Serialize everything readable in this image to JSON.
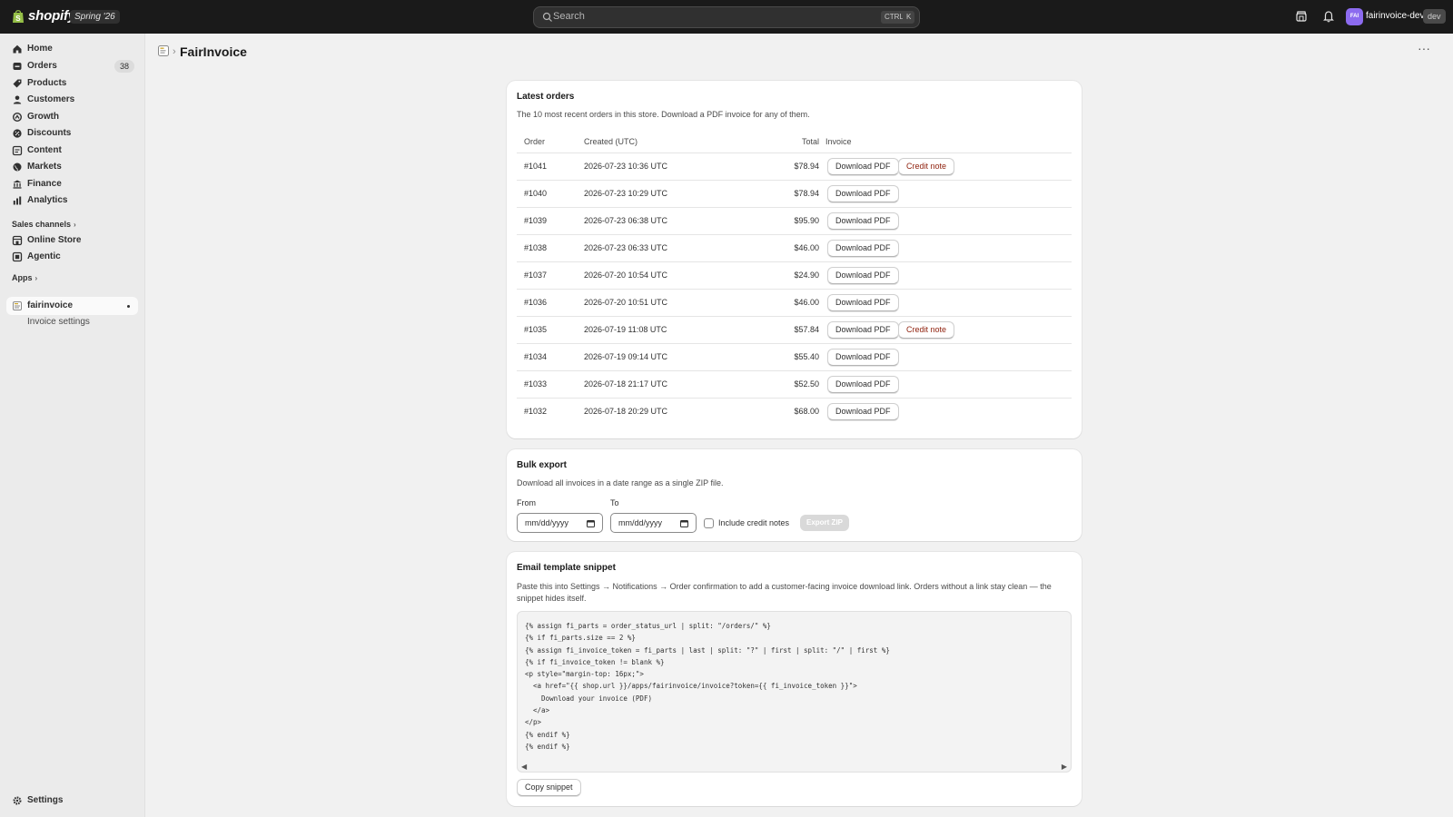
{
  "topbar": {
    "brand": "shopify",
    "edition": "Spring '26",
    "search_placeholder": "Search",
    "shortcut_ctrl": "CTRL",
    "shortcut_key": "K",
    "avatar_initials": "FAI",
    "store_name": "fairinvoice-dev",
    "env_badge": "dev"
  },
  "sidebar": {
    "items": [
      {
        "label": "Home",
        "icon": "home-icon"
      },
      {
        "label": "Orders",
        "icon": "orders-icon",
        "badge": "38"
      },
      {
        "label": "Products",
        "icon": "tag-icon"
      },
      {
        "label": "Customers",
        "icon": "person-icon"
      },
      {
        "label": "Growth",
        "icon": "growth-icon"
      },
      {
        "label": "Discounts",
        "icon": "discount-icon"
      },
      {
        "label": "Content",
        "icon": "content-icon"
      },
      {
        "label": "Markets",
        "icon": "globe-icon"
      },
      {
        "label": "Finance",
        "icon": "bank-icon"
      },
      {
        "label": "Analytics",
        "icon": "chart-icon"
      }
    ],
    "sales_channels_label": "Sales channels",
    "channels": [
      {
        "label": "Online Store",
        "icon": "store-icon"
      },
      {
        "label": "Agentic",
        "icon": "agentic-icon"
      }
    ],
    "apps_label": "Apps",
    "app_active": "fairinvoice",
    "app_sub": "Invoice settings",
    "settings_label": "Settings"
  },
  "page": {
    "title": "FairInvoice"
  },
  "orders": {
    "title": "Latest orders",
    "description": "The 10 most recent orders in this store. Download a PDF invoice for any of them.",
    "columns": [
      "Order",
      "Created (UTC)",
      "Total",
      "Invoice"
    ],
    "download_label": "Download PDF",
    "credit_label": "Credit note",
    "rows": [
      {
        "order": "#1041",
        "created": "2026-07-23 10:36 UTC",
        "total": "$78.94",
        "credit": true
      },
      {
        "order": "#1040",
        "created": "2026-07-23 10:29 UTC",
        "total": "$78.94",
        "credit": false
      },
      {
        "order": "#1039",
        "created": "2026-07-23 06:38 UTC",
        "total": "$95.90",
        "credit": false
      },
      {
        "order": "#1038",
        "created": "2026-07-23 06:33 UTC",
        "total": "$46.00",
        "credit": false
      },
      {
        "order": "#1037",
        "created": "2026-07-20 10:54 UTC",
        "total": "$24.90",
        "credit": false
      },
      {
        "order": "#1036",
        "created": "2026-07-20 10:51 UTC",
        "total": "$46.00",
        "credit": false
      },
      {
        "order": "#1035",
        "created": "2026-07-19 11:08 UTC",
        "total": "$57.84",
        "credit": true
      },
      {
        "order": "#1034",
        "created": "2026-07-19 09:14 UTC",
        "total": "$55.40",
        "credit": false
      },
      {
        "order": "#1033",
        "created": "2026-07-18 21:17 UTC",
        "total": "$52.50",
        "credit": false
      },
      {
        "order": "#1032",
        "created": "2026-07-18 20:29 UTC",
        "total": "$68.00",
        "credit": false
      }
    ]
  },
  "bulk": {
    "title": "Bulk export",
    "description": "Download all invoices in a date range as a single ZIP file.",
    "from_label": "From",
    "to_label": "To",
    "from_value": "mm/dd/yyyy",
    "to_value": "mm/dd/yyyy",
    "include_label": "Include credit notes",
    "export_label": "Export ZIP"
  },
  "email": {
    "title": "Email template snippet",
    "description": "Paste this into Settings → Notifications → Order confirmation to add a customer-facing invoice download link. Orders without a link stay clean — the snippet hides itself.",
    "code": "{% assign fi_parts = order_status_url | split: \"/orders/\" %}\n{% if fi_parts.size == 2 %}\n{% assign fi_invoice_token = fi_parts | last | split: \"?\" | first | split: \"/\" | first %}\n{% if fi_invoice_token != blank %}\n<p style=\"margin-top: 16px;\">\n  <a href=\"{{ shop.url }}/apps/fairinvoice/invoice?token={{ fi_invoice_token }}\">\n    Download your invoice (PDF)\n  </a>\n</p>\n{% endif %}\n{% endif %}",
    "copy_label": "Copy snippet"
  },
  "colors": {
    "topbar": "#1a1a1a",
    "critical": "#8e1f0b",
    "avatar": "#8c6bef"
  }
}
